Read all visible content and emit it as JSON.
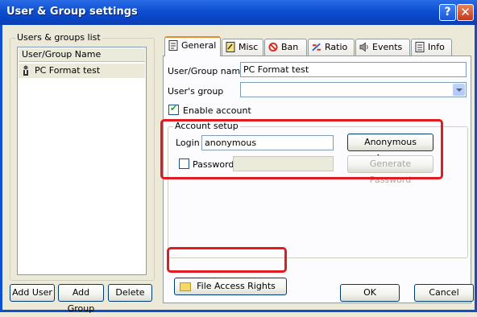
{
  "window": {
    "title": "User & Group settings",
    "help_glyph": "?",
    "close_glyph": "✕"
  },
  "left_panel": {
    "group_label": "Users & groups list",
    "column_header": "User/Group Name",
    "items": [
      {
        "label": "PC Format test",
        "icon": "user-icon"
      }
    ],
    "add_user_label": "Add User",
    "add_group_label": "Add Group",
    "delete_label": "Delete"
  },
  "tabs": [
    {
      "label": "General",
      "icon": "general-icon"
    },
    {
      "label": "Misc",
      "icon": "misc-icon"
    },
    {
      "label": "Ban",
      "icon": "ban-icon"
    },
    {
      "label": "Ratio",
      "icon": "ratio-icon"
    },
    {
      "label": "Events",
      "icon": "events-icon"
    },
    {
      "label": "Info",
      "icon": "info-icon"
    }
  ],
  "general": {
    "name_label": "User/Group name",
    "name_value": "PC Format test",
    "group_label": "User's group",
    "group_value": "",
    "enable_account_label": "Enable account",
    "enable_account_checked": true,
    "account_setup": {
      "label": "Account setup",
      "login_label": "Login",
      "login_value": "anonymous",
      "anonymous_access_label": "Anonymous Access",
      "password_label": "Password",
      "password_checked": false,
      "password_value": "",
      "generate_password_label": "Generate Password"
    },
    "file_access_rights_label": "File Access Rights"
  },
  "footer": {
    "ok_label": "OK",
    "cancel_label": "Cancel"
  },
  "colors": {
    "title_bar": "#0c4fd1",
    "highlight_box": "#e01b22",
    "dialog_bg": "#ece9d8"
  }
}
